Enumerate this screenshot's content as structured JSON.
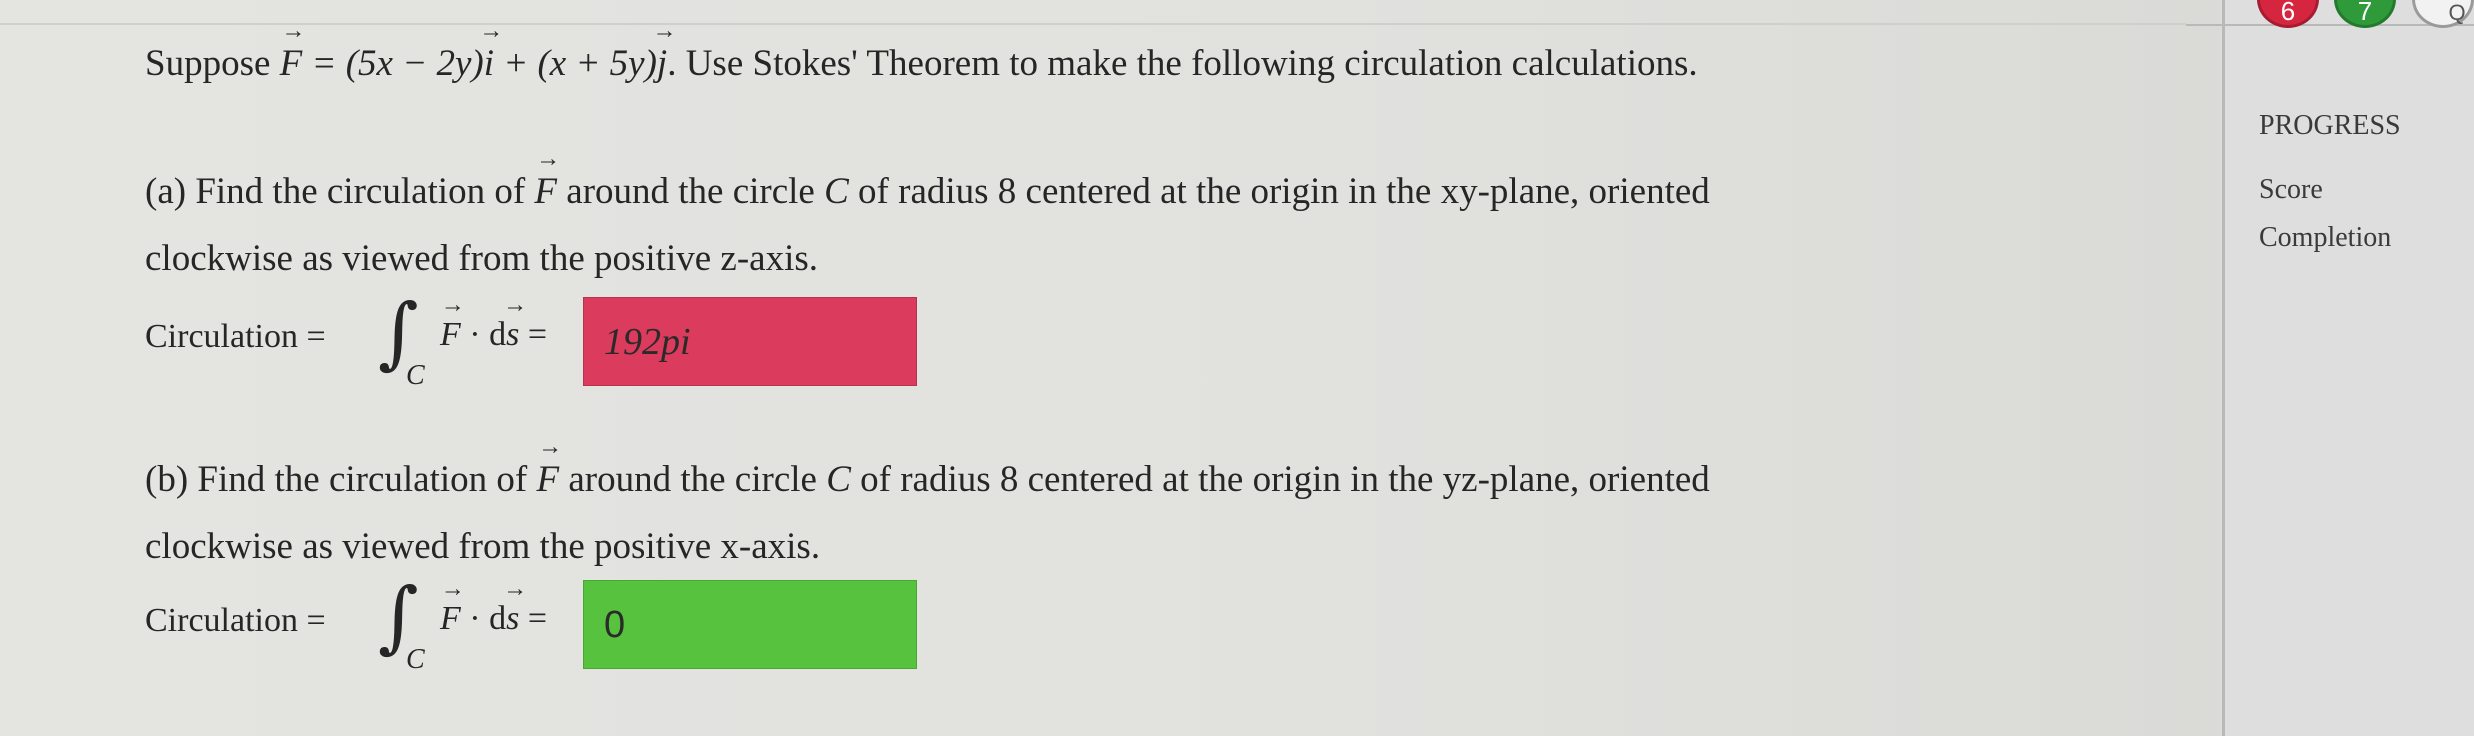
{
  "statement": {
    "prefix": "Suppose ",
    "F": "F",
    "formula": " = (5x − 2y)",
    "i": "i",
    "mid": " + (x + 5y)",
    "j": "j",
    "suffix": ". Use Stokes' Theorem to make the following circulation calculations."
  },
  "part_a": {
    "line1_pre": "(a) Find the circulation of ",
    "F": "F",
    "line1_mid": " around the circle ",
    "C": "C",
    "line1_post": " of radius 8 centered at the origin in the xy-plane, oriented",
    "line2": "clockwise as viewed from the positive z-axis.",
    "circ_label": "Circulation =",
    "integral_sym": "∫",
    "sub": "C",
    "integrand_F": "F",
    "dot": " · d",
    "s": "s",
    "eq": " =",
    "answer": "192pi",
    "answer_status": "incorrect",
    "answer_color": "#db3b5c"
  },
  "part_b": {
    "line1_pre": "(b) Find the circulation of ",
    "F": "F",
    "line1_mid": " around the circle ",
    "C": "C",
    "line1_post": " of radius 8 centered at the origin in the yz-plane, oriented",
    "line2": "clockwise as viewed from the positive x-axis.",
    "circ_label": "Circulation =",
    "integral_sym": "∫",
    "sub": "C",
    "integrand_F": "F",
    "dot": " · d",
    "s": "s",
    "eq": " =",
    "answer": "0",
    "answer_status": "correct",
    "answer_color": "#57c23d"
  },
  "sidebar": {
    "progress": "PROGRESS",
    "score": "Score",
    "completion": "Completion"
  },
  "top_buttons": [
    {
      "label": "6",
      "color": "#d6263f"
    },
    {
      "label": "7",
      "color": "#2f9a3a"
    },
    {
      "label": "Q",
      "color": "#f2f2f2"
    }
  ]
}
